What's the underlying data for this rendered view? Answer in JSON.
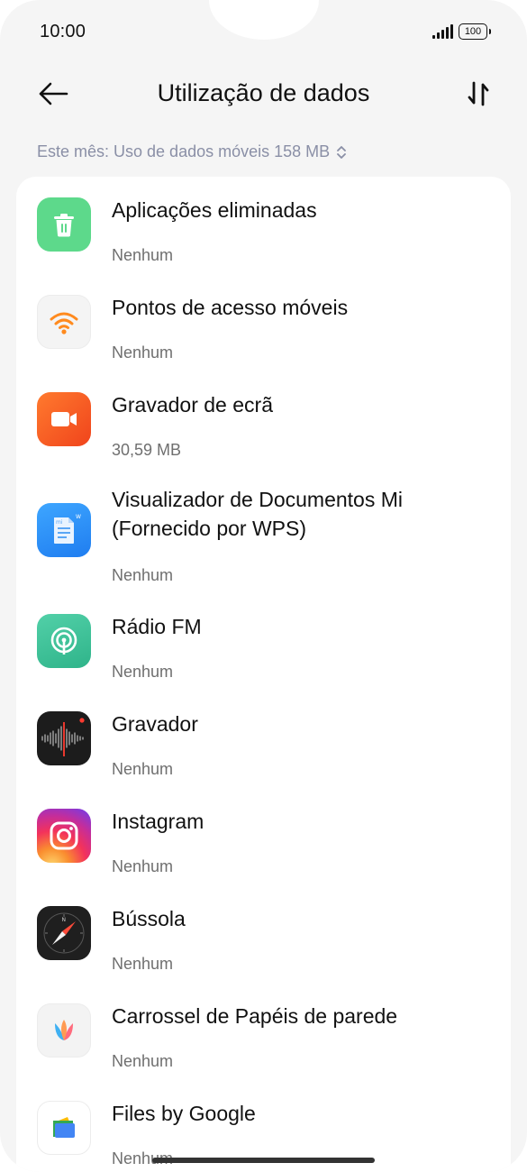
{
  "status_bar": {
    "time": "10:00",
    "battery": "100"
  },
  "header": {
    "title": "Utilização de dados"
  },
  "filter": {
    "label": "Este mês: Uso de dados móveis 158 MB"
  },
  "apps": [
    {
      "name": "Aplicações eliminadas",
      "usage": "Nenhum",
      "icon": "trash-icon"
    },
    {
      "name": "Pontos de acesso móveis",
      "usage": "Nenhum",
      "icon": "wifi-hotspot-icon"
    },
    {
      "name": "Gravador de ecrã",
      "usage": "30,59 MB",
      "icon": "screen-recorder-icon"
    },
    {
      "name_line1": "Visualizador de Documentos Mi",
      "name_line2": "(Fornecido por WPS)",
      "usage": "Nenhum",
      "icon": "document-viewer-icon"
    },
    {
      "name": "Rádio FM",
      "usage": "Nenhum",
      "icon": "fm-radio-icon"
    },
    {
      "name": "Gravador",
      "usage": "Nenhum",
      "icon": "voice-recorder-icon"
    },
    {
      "name": "Instagram",
      "usage": "Nenhum",
      "icon": "instagram-icon"
    },
    {
      "name": "Bússola",
      "usage": "Nenhum",
      "icon": "compass-icon"
    },
    {
      "name": "Carrossel de Papéis de parede",
      "usage": "Nenhum",
      "icon": "wallpaper-carousel-icon"
    },
    {
      "name": "Files by Google",
      "usage": "Nenhum",
      "icon": "files-by-google-icon"
    }
  ]
}
